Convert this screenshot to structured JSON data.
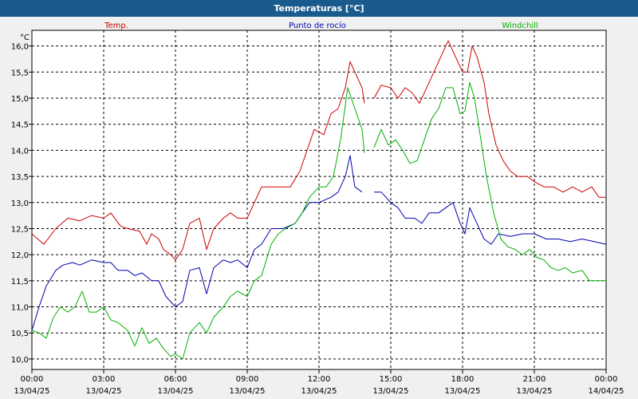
{
  "window": {
    "title": "Temperaturas [°C]"
  },
  "chart_data": {
    "type": "line",
    "title": "Temperaturas [°C]",
    "ylabel": "°C",
    "ylim": [
      9.8,
      16.3
    ],
    "yticks": [
      10.0,
      10.5,
      11.0,
      11.5,
      12.0,
      12.5,
      13.0,
      13.5,
      14.0,
      14.5,
      15.0,
      15.5,
      16.0
    ],
    "ytick_labels": [
      "10,0",
      "10,5",
      "11,0",
      "11,5",
      "12,0",
      "12,5",
      "13,0",
      "13,5",
      "14,0",
      "14,5",
      "15,0",
      "15,5",
      "16,0"
    ],
    "xlim_hours": [
      0,
      24
    ],
    "xticks": [
      {
        "time": "00:00",
        "date": "13/04/25"
      },
      {
        "time": "03:00",
        "date": "13/04/25"
      },
      {
        "time": "06:00",
        "date": "13/04/25"
      },
      {
        "time": "09:00",
        "date": "13/04/25"
      },
      {
        "time": "12:00",
        "date": "13/04/25"
      },
      {
        "time": "15:00",
        "date": "13/04/25"
      },
      {
        "time": "18:00",
        "date": "13/04/25"
      },
      {
        "time": "21:00",
        "date": "13/04/25"
      },
      {
        "time": "00:00",
        "date": "14/04/25"
      }
    ],
    "grid": true,
    "legend_position": "top",
    "series": [
      {
        "name": "Temp.",
        "color": "#cc0000",
        "segments": [
          [
            [
              0,
              12.4
            ],
            [
              0.5,
              12.2
            ],
            [
              1,
              12.5
            ],
            [
              1.5,
              12.7
            ],
            [
              2,
              12.65
            ],
            [
              2.5,
              12.75
            ],
            [
              3,
              12.7
            ],
            [
              3.3,
              12.8
            ],
            [
              3.7,
              12.55
            ],
            [
              4,
              12.5
            ],
            [
              4.5,
              12.45
            ],
            [
              4.8,
              12.2
            ],
            [
              5,
              12.4
            ],
            [
              5.3,
              12.3
            ],
            [
              5.5,
              12.1
            ],
            [
              5.8,
              12.0
            ],
            [
              6,
              11.9
            ],
            [
              6.3,
              12.1
            ],
            [
              6.6,
              12.6
            ],
            [
              7,
              12.7
            ],
            [
              7.3,
              12.1
            ],
            [
              7.6,
              12.5
            ],
            [
              8,
              12.7
            ],
            [
              8.3,
              12.8
            ],
            [
              8.6,
              12.7
            ],
            [
              9,
              12.7
            ],
            [
              9.3,
              13.0
            ],
            [
              9.6,
              13.3
            ],
            [
              10,
              13.3
            ],
            [
              10.5,
              13.3
            ],
            [
              10.8,
              13.3
            ],
            [
              11.2,
              13.6
            ],
            [
              11.5,
              14.0
            ],
            [
              11.8,
              14.4
            ],
            [
              12.2,
              14.3
            ],
            [
              12.5,
              14.7
            ],
            [
              12.8,
              14.8
            ],
            [
              13.1,
              15.2
            ],
            [
              13.3,
              15.7
            ],
            [
              13.6,
              15.4
            ],
            [
              13.8,
              15.2
            ],
            [
              13.9,
              14.9
            ]
          ],
          [
            [
              14.3,
              15.0
            ],
            [
              14.6,
              15.25
            ],
            [
              15,
              15.2
            ],
            [
              15.3,
              15.0
            ],
            [
              15.6,
              15.2
            ],
            [
              15.9,
              15.1
            ],
            [
              16.2,
              14.9
            ],
            [
              16.5,
              15.2
            ],
            [
              16.8,
              15.5
            ],
            [
              17.1,
              15.8
            ],
            [
              17.4,
              16.1
            ],
            [
              17.7,
              15.8
            ],
            [
              18,
              15.5
            ],
            [
              18.2,
              15.5
            ],
            [
              18.4,
              16.0
            ],
            [
              18.6,
              15.8
            ],
            [
              18.9,
              15.3
            ],
            [
              19.1,
              14.7
            ],
            [
              19.4,
              14.1
            ],
            [
              19.7,
              13.8
            ],
            [
              20,
              13.6
            ],
            [
              20.3,
              13.5
            ],
            [
              20.7,
              13.5
            ],
            [
              21,
              13.4
            ],
            [
              21.4,
              13.3
            ],
            [
              21.8,
              13.3
            ],
            [
              22.2,
              13.2
            ],
            [
              22.6,
              13.3
            ],
            [
              23,
              13.2
            ],
            [
              23.4,
              13.3
            ],
            [
              23.7,
              13.1
            ],
            [
              24,
              13.1
            ]
          ]
        ]
      },
      {
        "name": "Punto de rocío",
        "color": "#0000b0",
        "segments": [
          [
            [
              0,
              10.55
            ],
            [
              0.3,
              11.0
            ],
            [
              0.6,
              11.4
            ],
            [
              1,
              11.7
            ],
            [
              1.3,
              11.8
            ],
            [
              1.7,
              11.85
            ],
            [
              2,
              11.8
            ],
            [
              2.5,
              11.9
            ],
            [
              3,
              11.85
            ],
            [
              3.3,
              11.85
            ],
            [
              3.6,
              11.7
            ],
            [
              4,
              11.7
            ],
            [
              4.3,
              11.6
            ],
            [
              4.6,
              11.65
            ],
            [
              5,
              11.5
            ],
            [
              5.3,
              11.5
            ],
            [
              5.6,
              11.2
            ],
            [
              5.8,
              11.1
            ],
            [
              6,
              11.0
            ],
            [
              6.3,
              11.1
            ],
            [
              6.6,
              11.7
            ],
            [
              7,
              11.75
            ],
            [
              7.3,
              11.25
            ],
            [
              7.6,
              11.75
            ],
            [
              8,
              11.9
            ],
            [
              8.3,
              11.85
            ],
            [
              8.6,
              11.9
            ],
            [
              9,
              11.75
            ],
            [
              9.3,
              12.1
            ],
            [
              9.6,
              12.2
            ],
            [
              10,
              12.5
            ],
            [
              10.5,
              12.5
            ],
            [
              11,
              12.6
            ],
            [
              11.3,
              12.8
            ],
            [
              11.6,
              13.0
            ],
            [
              12,
              13.0
            ],
            [
              12.5,
              13.1
            ],
            [
              12.8,
              13.2
            ],
            [
              13.1,
              13.5
            ],
            [
              13.3,
              13.9
            ],
            [
              13.5,
              13.3
            ],
            [
              13.8,
              13.2
            ]
          ],
          [
            [
              14.3,
              13.2
            ],
            [
              14.6,
              13.2
            ],
            [
              15,
              13.0
            ],
            [
              15.3,
              12.9
            ],
            [
              15.6,
              12.7
            ],
            [
              16,
              12.7
            ],
            [
              16.3,
              12.6
            ],
            [
              16.6,
              12.8
            ],
            [
              17,
              12.8
            ],
            [
              17.3,
              12.9
            ],
            [
              17.6,
              13.0
            ],
            [
              17.9,
              12.6
            ],
            [
              18.1,
              12.4
            ],
            [
              18.3,
              12.9
            ],
            [
              18.6,
              12.6
            ],
            [
              18.9,
              12.3
            ],
            [
              19.2,
              12.2
            ],
            [
              19.5,
              12.4
            ],
            [
              20,
              12.35
            ],
            [
              20.5,
              12.4
            ],
            [
              21,
              12.4
            ],
            [
              21.5,
              12.3
            ],
            [
              22,
              12.3
            ],
            [
              22.5,
              12.25
            ],
            [
              23,
              12.3
            ],
            [
              23.5,
              12.25
            ],
            [
              24,
              12.2
            ]
          ]
        ]
      },
      {
        "name": "Windchill",
        "color": "#00b000",
        "segments": [
          [
            [
              0,
              10.55
            ],
            [
              0.3,
              10.5
            ],
            [
              0.6,
              10.4
            ],
            [
              0.9,
              10.8
            ],
            [
              1.2,
              11.0
            ],
            [
              1.5,
              10.9
            ],
            [
              1.8,
              11.0
            ],
            [
              2.1,
              11.3
            ],
            [
              2.4,
              10.9
            ],
            [
              2.7,
              10.9
            ],
            [
              3,
              11.0
            ],
            [
              3.3,
              10.75
            ],
            [
              3.6,
              10.7
            ],
            [
              4,
              10.55
            ],
            [
              4.3,
              10.25
            ],
            [
              4.6,
              10.6
            ],
            [
              4.9,
              10.3
            ],
            [
              5.2,
              10.4
            ],
            [
              5.5,
              10.2
            ],
            [
              5.8,
              10.05
            ],
            [
              6,
              10.1
            ],
            [
              6.3,
              10.0
            ],
            [
              6.6,
              10.5
            ],
            [
              7,
              10.7
            ],
            [
              7.3,
              10.5
            ],
            [
              7.6,
              10.8
            ],
            [
              8,
              11.0
            ],
            [
              8.3,
              11.2
            ],
            [
              8.6,
              11.3
            ],
            [
              9,
              11.2
            ],
            [
              9.3,
              11.5
            ],
            [
              9.6,
              11.6
            ],
            [
              10,
              12.2
            ],
            [
              10.3,
              12.4
            ],
            [
              10.6,
              12.5
            ],
            [
              11,
              12.6
            ],
            [
              11.3,
              12.8
            ],
            [
              11.6,
              13.1
            ],
            [
              12,
              13.3
            ],
            [
              12.3,
              13.3
            ],
            [
              12.6,
              13.5
            ],
            [
              12.9,
              14.2
            ],
            [
              13.2,
              15.2
            ],
            [
              13.5,
              14.8
            ],
            [
              13.8,
              14.4
            ],
            [
              13.9,
              13.95
            ]
          ],
          [
            [
              14.3,
              14.05
            ],
            [
              14.6,
              14.4
            ],
            [
              14.9,
              14.1
            ],
            [
              15.2,
              14.2
            ],
            [
              15.5,
              14.0
            ],
            [
              15.8,
              13.75
            ],
            [
              16.1,
              13.8
            ],
            [
              16.4,
              14.2
            ],
            [
              16.7,
              14.6
            ],
            [
              17,
              14.8
            ],
            [
              17.3,
              15.2
            ],
            [
              17.6,
              15.2
            ],
            [
              17.9,
              14.7
            ],
            [
              18.1,
              14.75
            ],
            [
              18.3,
              15.3
            ],
            [
              18.5,
              15.0
            ],
            [
              18.7,
              14.4
            ],
            [
              19,
              13.5
            ],
            [
              19.3,
              12.8
            ],
            [
              19.6,
              12.3
            ],
            [
              19.9,
              12.15
            ],
            [
              20.2,
              12.1
            ],
            [
              20.5,
              12.0
            ],
            [
              20.8,
              12.1
            ],
            [
              21.1,
              11.95
            ],
            [
              21.4,
              11.9
            ],
            [
              21.7,
              11.75
            ],
            [
              22,
              11.7
            ],
            [
              22.3,
              11.75
            ],
            [
              22.6,
              11.65
            ],
            [
              23,
              11.7
            ],
            [
              23.3,
              11.5
            ],
            [
              23.6,
              11.5
            ],
            [
              24,
              11.5
            ]
          ]
        ]
      }
    ]
  }
}
